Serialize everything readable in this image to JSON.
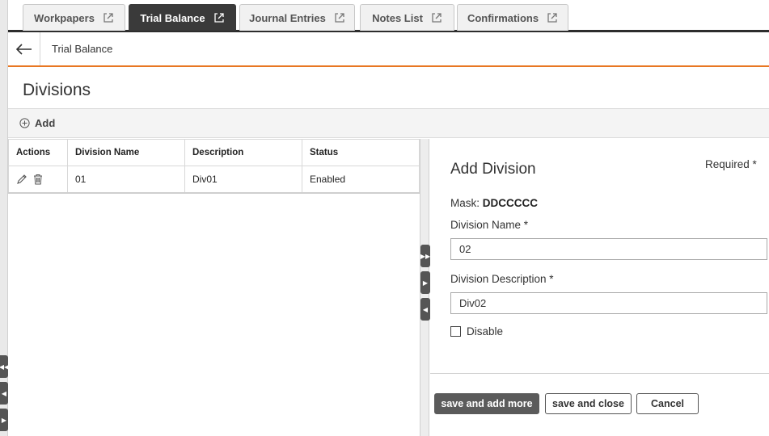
{
  "tabs": [
    {
      "label": "Workpapers",
      "active": false
    },
    {
      "label": "Trial Balance",
      "active": true
    },
    {
      "label": "Journal Entries",
      "active": false
    },
    {
      "label": "Notes List",
      "active": false
    },
    {
      "label": "Confirmations",
      "active": false
    }
  ],
  "header": {
    "subtitle": "Trial Balance",
    "back_icon": "arrow-left-icon"
  },
  "page": {
    "title": "Divisions"
  },
  "toolbar": {
    "add_label": "Add",
    "add_icon": "plus-circle-icon"
  },
  "table": {
    "columns": [
      "Actions",
      "Division Name",
      "Description",
      "Status"
    ],
    "rows": [
      {
        "division_name": "01",
        "description": "Div01",
        "status": "Enabled",
        "action_icons": [
          "pencil-icon",
          "trash-icon"
        ]
      }
    ]
  },
  "form": {
    "title": "Add Division",
    "required_note": "Required *",
    "mask_label": "Mask:",
    "mask_value": "DDCCCCC",
    "name_label": "Division Name  *",
    "name_value": "02",
    "description_label": "Division Description  *",
    "description_value": "Div02",
    "disable_label": "Disable",
    "disable_checked": false,
    "buttons": {
      "save_add_more": "save and add more",
      "save_close": "save and close",
      "cancel": "Cancel"
    }
  },
  "colors": {
    "accent": "#e87722",
    "tab_active": "#3a3a3a",
    "primary_button": "#5b5b5b"
  }
}
